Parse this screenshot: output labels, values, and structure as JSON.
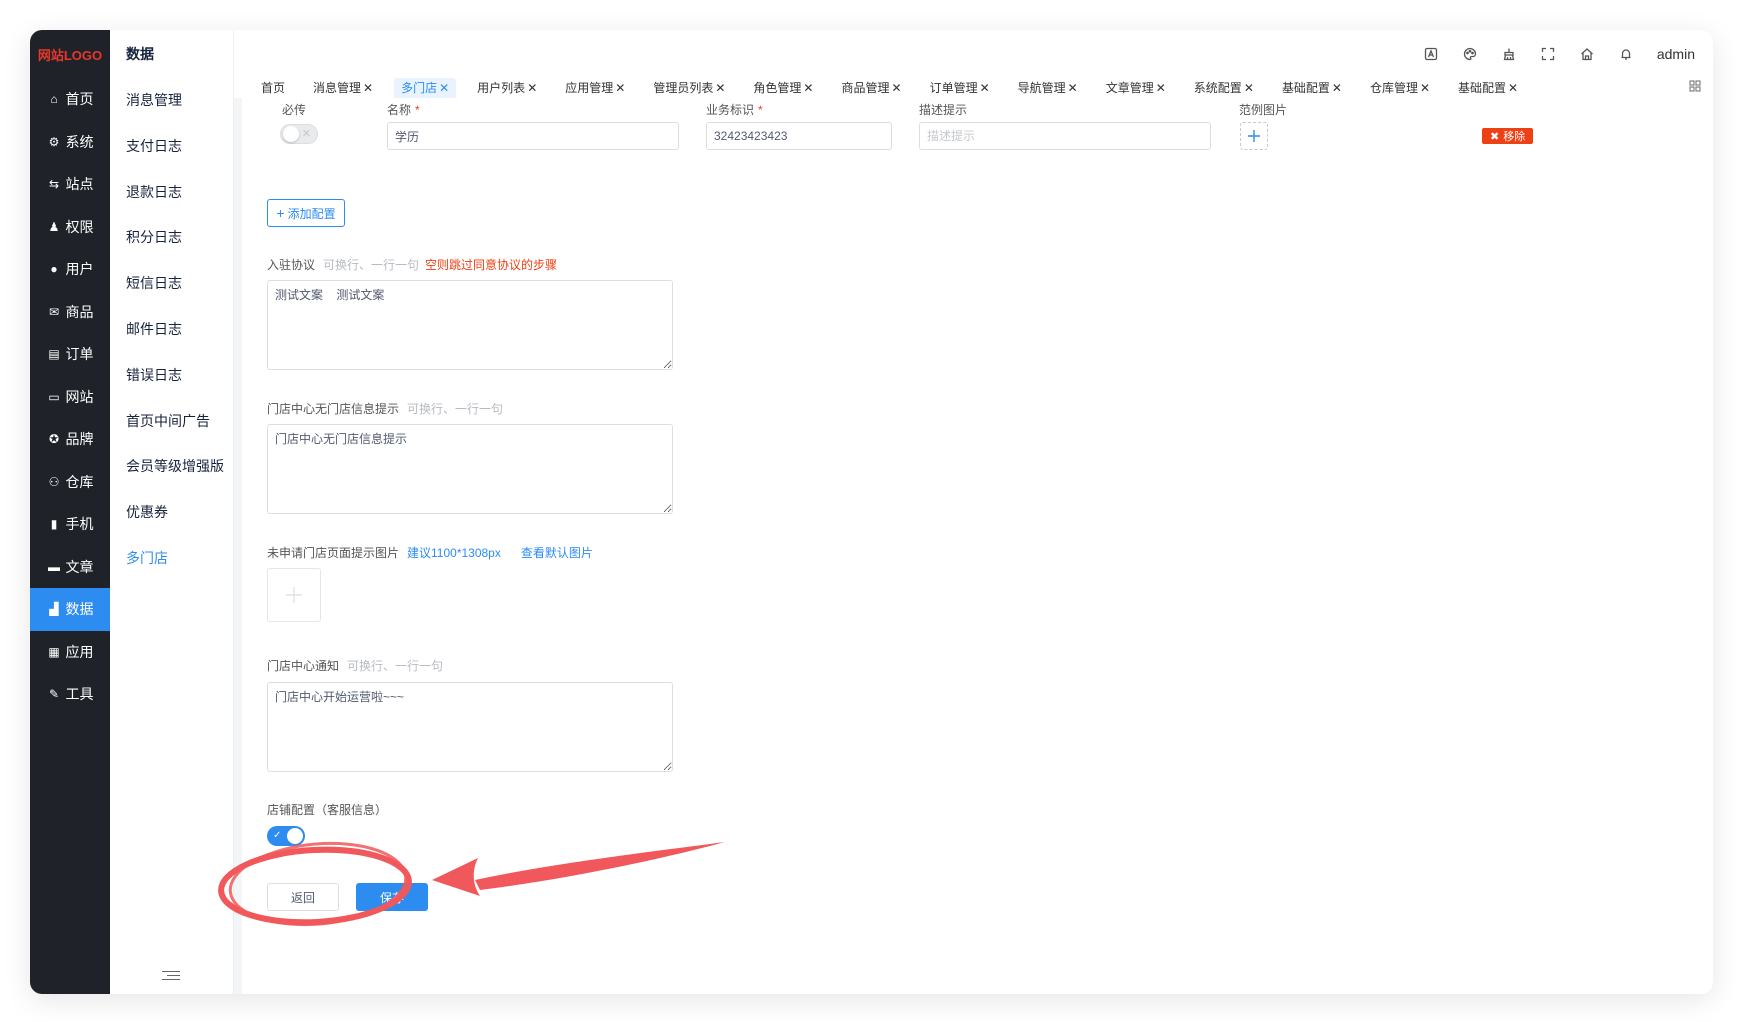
{
  "app": {
    "logo_text": "网站LOGO"
  },
  "main_nav": {
    "items": [
      {
        "label": "首页",
        "icon": "home-icon"
      },
      {
        "label": "系统",
        "icon": "gear-icon"
      },
      {
        "label": "站点",
        "icon": "sliders-icon"
      },
      {
        "label": "权限",
        "icon": "user-lock-icon"
      },
      {
        "label": "用户",
        "icon": "user-icon"
      },
      {
        "label": "商品",
        "icon": "mail-icon"
      },
      {
        "label": "订单",
        "icon": "clipboard-icon"
      },
      {
        "label": "网站",
        "icon": "monitor-icon"
      },
      {
        "label": "品牌",
        "icon": "award-icon"
      },
      {
        "label": "仓库",
        "icon": "sitemap-icon"
      },
      {
        "label": "手机",
        "icon": "phone-icon"
      },
      {
        "label": "文章",
        "icon": "document-icon"
      },
      {
        "label": "数据",
        "icon": "bar-chart-icon"
      },
      {
        "label": "应用",
        "icon": "grid-icon"
      },
      {
        "label": "工具",
        "icon": "wrench-icon"
      }
    ],
    "active": "数据"
  },
  "sub_nav": {
    "title": "数据",
    "items": [
      "消息管理",
      "支付日志",
      "退款日志",
      "积分日志",
      "短信日志",
      "邮件日志",
      "错误日志",
      "首页中间广告",
      "会员等级增强版",
      "优惠券",
      "多门店"
    ],
    "active": "多门店"
  },
  "header": {
    "user": "admin",
    "icons": [
      "translate-icon",
      "palette-icon",
      "cleanup-icon",
      "fullscreen-icon",
      "home-icon",
      "bell-icon"
    ]
  },
  "tabs": {
    "items": [
      {
        "label": "首页",
        "closable": false
      },
      {
        "label": "消息管理",
        "closable": true
      },
      {
        "label": "多门店",
        "closable": true
      },
      {
        "label": "用户列表",
        "closable": true
      },
      {
        "label": "应用管理",
        "closable": true
      },
      {
        "label": "管理员列表",
        "closable": true
      },
      {
        "label": "角色管理",
        "closable": true
      },
      {
        "label": "商品管理",
        "closable": true
      },
      {
        "label": "订单管理",
        "closable": true
      },
      {
        "label": "导航管理",
        "closable": true
      },
      {
        "label": "文章管理",
        "closable": true
      },
      {
        "label": "系统配置",
        "closable": true
      },
      {
        "label": "基础配置",
        "closable": true
      },
      {
        "label": "仓库管理",
        "closable": true
      },
      {
        "label": "基础配置",
        "closable": true
      }
    ],
    "active_index": 2,
    "close_glyph": "✕"
  },
  "config_row": {
    "required_label": "必传",
    "name_label": "名称",
    "name_value": "学历",
    "key_label": "业务标识",
    "key_value": "32423423423",
    "desc_label": "描述提示",
    "desc_placeholder": "描述提示",
    "example_label": "范例图片",
    "required_star": "*",
    "remove_label": "移除"
  },
  "add_config": {
    "label": "添加配置"
  },
  "agreement": {
    "label": "入驻协议",
    "hint": "可换行、一行一句",
    "warning": "空则跳过同意协议的步骤",
    "value": "测试文案    测试文案"
  },
  "no_store_tip": {
    "label": "门店中心无门店信息提示",
    "hint": "可换行、一行一句",
    "value": "门店中心无门店信息提示"
  },
  "unapplied_image": {
    "label": "未申请门店页面提示图片",
    "suggest": "建议1100*1308px",
    "view_default": "查看默认图片"
  },
  "store_notice": {
    "label": "门店中心通知",
    "hint": "可换行、一行一句",
    "value": "门店中心开始运营啦~~~"
  },
  "shop_config": {
    "label": "店铺配置（客服信息）",
    "enabled": true
  },
  "actions": {
    "back": "返回",
    "save": "保存"
  },
  "colors": {
    "primary": "#2d8cf0",
    "danger": "#ed4014",
    "sidebar": "#1f2329",
    "annotation": "#f0585b"
  }
}
